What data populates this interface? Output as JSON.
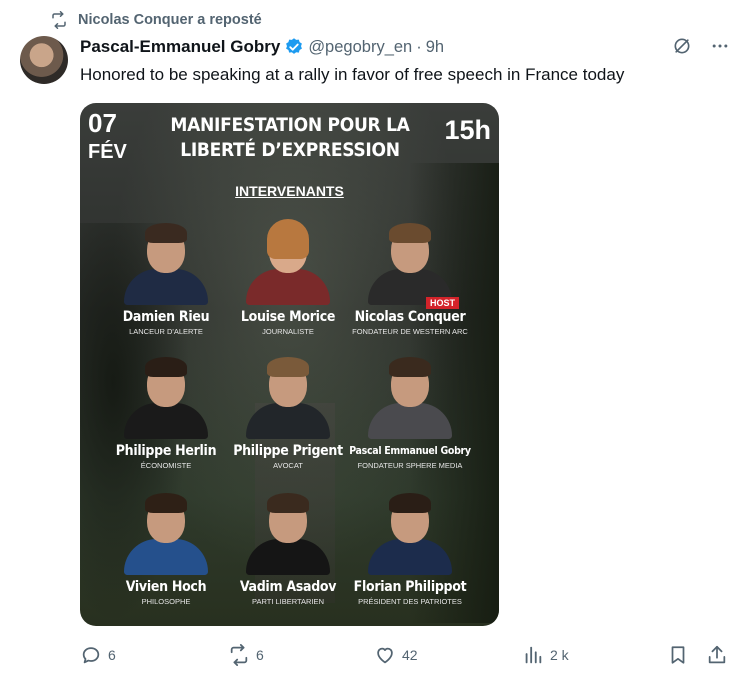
{
  "repost": {
    "text": "Nicolas Conquer a reposté",
    "icon": "repost-icon"
  },
  "author": {
    "name": "Pascal-Emmanuel Gobry",
    "handle": "@pegobry_en",
    "separator": "·",
    "time": "9h"
  },
  "tweet": {
    "text": "Honored to be speaking at a rally in favor of free speech in France today"
  },
  "poster": {
    "day": "07",
    "month": "FÉV",
    "time": "15h",
    "title_line1": "MANIFESTATION POUR LA",
    "title_line2": "LIBERTÉ D’EXPRESSION",
    "subtitle": "INTERVENANTS",
    "host_badge": "HOST",
    "speakers": [
      {
        "name": "Damien Rieu",
        "role": "LANCEUR D'ALERTE"
      },
      {
        "name": "Louise Morice",
        "role": "JOURNALISTE"
      },
      {
        "name": "Nicolas Conquer",
        "role": "FONDATEUR DE WESTERN ARC"
      },
      {
        "name": "Philippe Herlin",
        "role": "ÉCONOMISTE"
      },
      {
        "name": "Philippe Prigent",
        "role": "AVOCAT"
      },
      {
        "name": "Pascal Emmanuel Gobry",
        "role": "FONDATEUR SPHERE MEDIA"
      },
      {
        "name": "Vivien Hoch",
        "role": "PHILOSOPHE"
      },
      {
        "name": "Vadim Asadov",
        "role": "PARTI LIBERTARIEN"
      },
      {
        "name": "Florian Philippot",
        "role": "PRÉSIDENT DES PATRIOTES"
      }
    ]
  },
  "actions": {
    "replies": "6",
    "reposts": "6",
    "likes": "42",
    "views": "2 k"
  },
  "colors": {
    "verified": "#1d9bf0",
    "secondary_text": "#536471",
    "host_badge": "#d3232a"
  }
}
